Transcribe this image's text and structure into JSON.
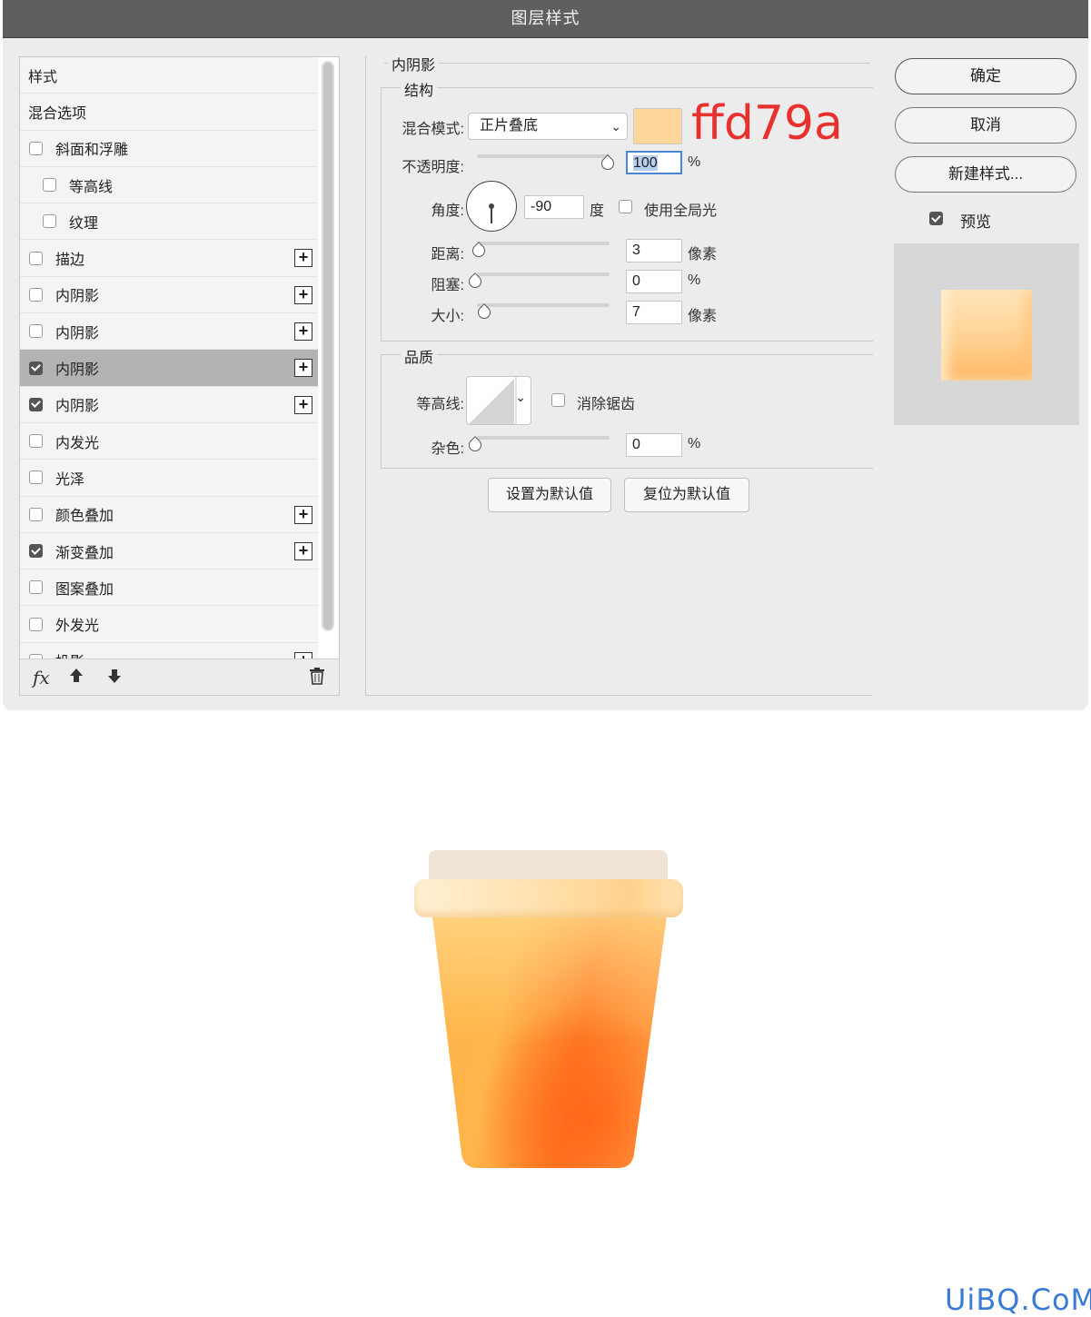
{
  "dialog": {
    "title": "图层样式",
    "style_list": [
      {
        "label": "样式",
        "type": "header"
      },
      {
        "label": "混合选项",
        "type": "header"
      },
      {
        "label": "斜面和浮雕",
        "checked": false,
        "indent": false,
        "plus": false
      },
      {
        "label": "等高线",
        "checked": false,
        "indent": true,
        "plus": false
      },
      {
        "label": "纹理",
        "checked": false,
        "indent": true,
        "plus": false
      },
      {
        "label": "描边",
        "checked": false,
        "indent": false,
        "plus": true
      },
      {
        "label": "内阴影",
        "checked": false,
        "indent": false,
        "plus": true
      },
      {
        "label": "内阴影",
        "checked": false,
        "indent": false,
        "plus": true
      },
      {
        "label": "内阴影",
        "checked": true,
        "indent": false,
        "plus": true,
        "selected": true
      },
      {
        "label": "内阴影",
        "checked": true,
        "indent": false,
        "plus": true
      },
      {
        "label": "内发光",
        "checked": false,
        "indent": false,
        "plus": false
      },
      {
        "label": "光泽",
        "checked": false,
        "indent": false,
        "plus": false
      },
      {
        "label": "颜色叠加",
        "checked": false,
        "indent": false,
        "plus": true
      },
      {
        "label": "渐变叠加",
        "checked": true,
        "indent": false,
        "plus": true
      },
      {
        "label": "图案叠加",
        "checked": false,
        "indent": false,
        "plus": false
      },
      {
        "label": "外发光",
        "checked": false,
        "indent": false,
        "plus": false
      },
      {
        "label": "投影",
        "checked": false,
        "indent": false,
        "plus": true
      }
    ],
    "footer": {
      "fx": "fx",
      "up": "🠅",
      "down": "🠇",
      "trash": "🗑"
    },
    "inner_shadow": {
      "section_title": "内阴影",
      "structure_title": "结构",
      "blend_mode_label": "混合模式:",
      "blend_mode_value": "正片叠底",
      "color_hex": "#ffd79a",
      "annotation": "ffd79a",
      "opacity_label": "不透明度:",
      "opacity_value": "100",
      "opacity_unit": "%",
      "angle_label": "角度:",
      "angle_value": "-90",
      "angle_unit": "度",
      "global_light_label": "使用全局光",
      "distance_label": "距离:",
      "distance_value": "3",
      "distance_unit": "像素",
      "choke_label": "阻塞:",
      "choke_value": "0",
      "choke_unit": "%",
      "size_label": "大小:",
      "size_value": "7",
      "size_unit": "像素",
      "quality_title": "品质",
      "contour_label": "等高线:",
      "antialias_label": "消除锯齿",
      "noise_label": "杂色:",
      "noise_value": "0",
      "noise_unit": "%",
      "set_default_label": "设置为默认值",
      "reset_default_label": "复位为默认值"
    },
    "right": {
      "ok_label": "确定",
      "cancel_label": "取消",
      "new_style_label": "新建样式...",
      "preview_label": "预览",
      "preview_checked": true
    }
  },
  "watermark": "UiBQ.CoM",
  "colors": {
    "accent_annotation": "#e8312f",
    "cup_orange": "#ff8a2c",
    "lid": "#ffd79a"
  }
}
